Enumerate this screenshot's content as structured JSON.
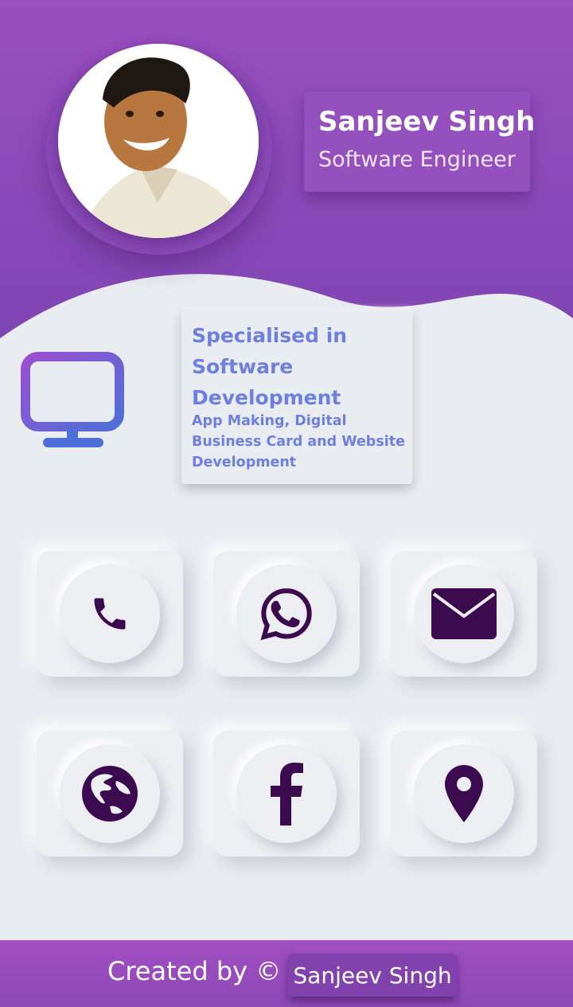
{
  "profile": {
    "name": "Sanjeev Singh",
    "role": "Software Engineer"
  },
  "specialisation": {
    "title": "Specialised in Software Development",
    "subtitle": "App Making, Digital Business Card and Website Development"
  },
  "actions": [
    {
      "id": "phone",
      "icon": "phone-icon"
    },
    {
      "id": "whatsapp",
      "icon": "whatsapp-icon"
    },
    {
      "id": "email",
      "icon": "envelope-icon"
    },
    {
      "id": "website",
      "icon": "globe-icon"
    },
    {
      "id": "facebook",
      "icon": "facebook-icon"
    },
    {
      "id": "location",
      "icon": "map-pin-icon"
    }
  ],
  "footer": {
    "created_by": "Created by ©",
    "author_button": "Sanjeev Singh"
  },
  "colors": {
    "header_purple": "#9b4fc0",
    "accent_blue": "#6f7fe0",
    "icon_dark": "#3b0a4f",
    "background": "#e9ecf1"
  }
}
